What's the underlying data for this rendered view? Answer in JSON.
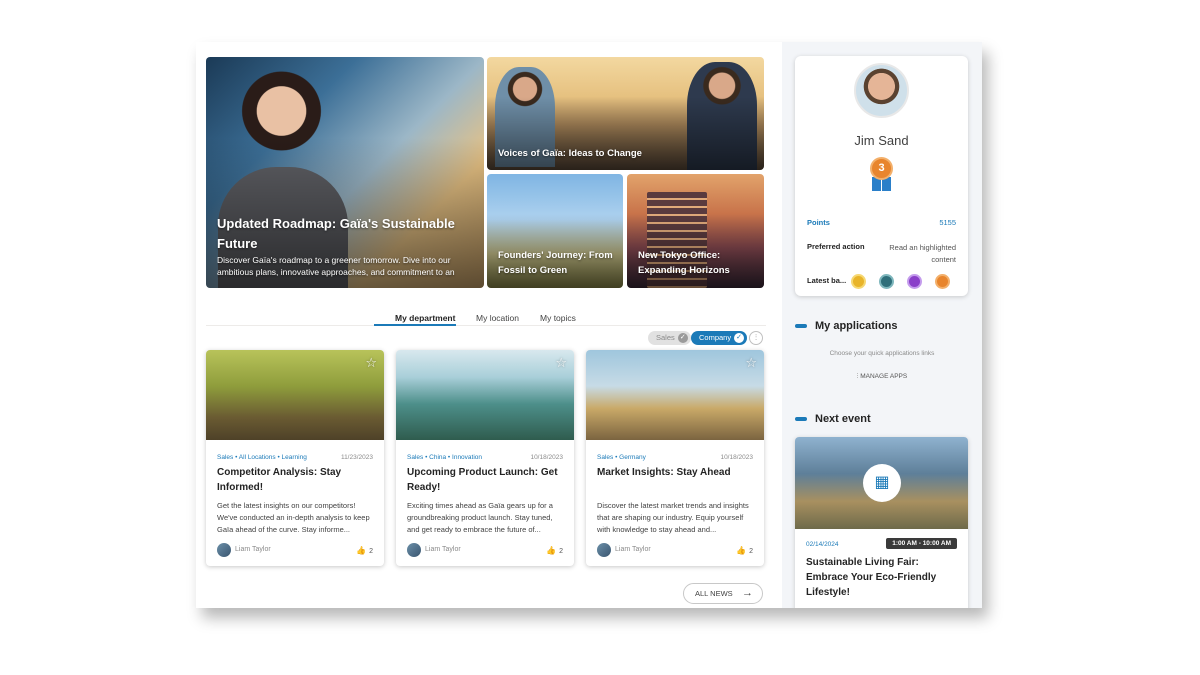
{
  "hero": {
    "main": {
      "title": "Updated Roadmap: Gaïa's Sustainable Future",
      "description": "Discover Gaïa's roadmap to a greener tomorrow. Dive into our ambitious plans, innovative approaches, and commitment to an ecofriendly future."
    },
    "top_right": {
      "title": "Voices of Gaïa: Ideas to Change"
    },
    "bottom_left": {
      "title": "Founders' Journey: From Fossil to Green"
    },
    "bottom_right": {
      "title": "New Tokyo Office: Expanding Horizons"
    }
  },
  "tabs": [
    {
      "label": "My department",
      "active": true
    },
    {
      "label": "My location",
      "active": false
    },
    {
      "label": "My topics",
      "active": false
    }
  ],
  "filters": [
    {
      "label": "Sales",
      "selected": false
    },
    {
      "label": "Company",
      "selected": true
    }
  ],
  "news": [
    {
      "tags": "Sales  •  All Locations  •  Learning",
      "date": "11/23/2023",
      "title": "Competitor Analysis: Stay Informed!",
      "body": "Get the latest insights on our competitors! We've conducted an in-depth analysis to keep Gaïa ahead of the curve. Stay informe...",
      "author": "Liam Taylor",
      "likes": "2"
    },
    {
      "tags": "Sales  •  China  •  Innovation",
      "date": "10/18/2023",
      "title": "Upcoming Product Launch: Get Ready!",
      "body": "Exciting times ahead as Gaïa gears up for a groundbreaking product launch. Stay tuned, and get ready to embrace the future of...",
      "author": "Liam Taylor",
      "likes": "2"
    },
    {
      "tags": "Sales  •  Germany",
      "date": "10/18/2023",
      "title": "Market Insights: Stay Ahead",
      "body": "Discover the latest market trends and insights that are shaping our industry. Equip yourself with knowledge to stay ahead and...",
      "author": "Liam Taylor",
      "likes": "2"
    }
  ],
  "all_news_label": "ALL NEWS",
  "profile": {
    "name": "Jim Sand",
    "level": "3",
    "points_label": "Points",
    "points_value": "5155",
    "preferred_label": "Preferred action",
    "preferred_value": "Read an highlighted content",
    "badges_label": "Latest ba...",
    "badge_colors": [
      "#e8b42a",
      "#2f6f7a",
      "#8a3fc9",
      "#e8852d"
    ]
  },
  "applications": {
    "title": "My applications",
    "hint": "Choose your quick applications links",
    "manage_label": "MANAGE APPS"
  },
  "next_event": {
    "title": "Next event",
    "date": "02/14/2024",
    "time": "1:00 AM - 10:00 AM",
    "event_title": "Sustainable Living Fair: Embrace Your Eco-Friendly Lifestyle!"
  },
  "colors": {
    "accent": "#1b7ab8"
  }
}
